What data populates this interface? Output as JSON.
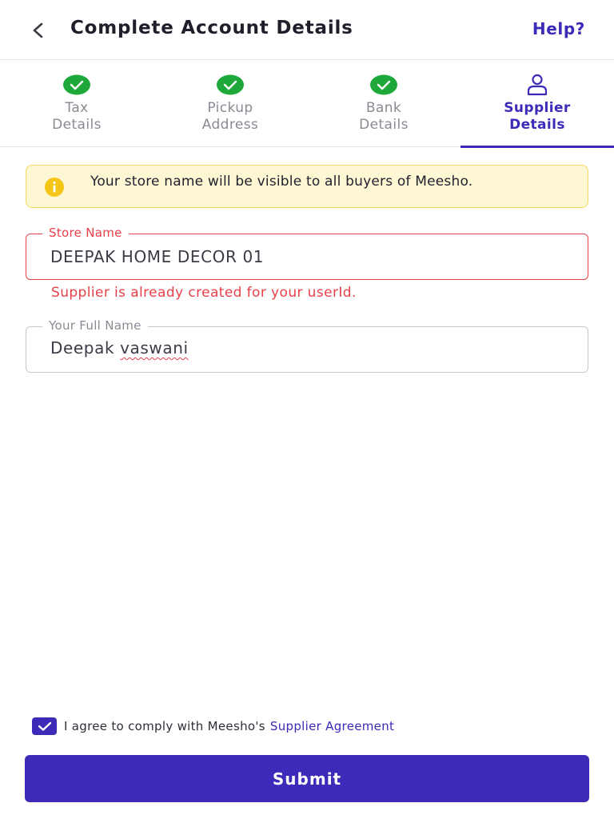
{
  "header": {
    "title": "Complete Account Details",
    "help_label": "Help?",
    "back_icon": "chevron-left-icon"
  },
  "steps": [
    {
      "label": "Tax\nDetails",
      "icon": "check-circle-icon",
      "status": "completed"
    },
    {
      "label": "Pickup\nAddress",
      "icon": "check-circle-icon",
      "status": "completed"
    },
    {
      "label": "Bank\nDetails",
      "icon": "check-circle-icon",
      "status": "completed"
    },
    {
      "label": "Supplier\nDetails",
      "icon": "user-icon",
      "status": "active"
    }
  ],
  "info_banner": {
    "text": "Your store name will be visible to all buyers of Meesho.",
    "icon": "info-icon"
  },
  "form": {
    "store_name": {
      "label": "Store Name",
      "value": "DEEPAK HOME DECOR 01",
      "error": "Supplier is already created for your userId."
    },
    "full_name": {
      "label": "Your Full Name",
      "value_first": "Deepak",
      "value_second": "vaswani"
    }
  },
  "agreement": {
    "checked": true,
    "text": "I agree to comply with Meesho's",
    "link_text": "Supplier Agreement"
  },
  "submit_label": "Submit",
  "colors": {
    "primary": "#3b2bb8",
    "success": "#1fa83a",
    "error": "#e8404a",
    "banner_bg": "#fdf7d4",
    "banner_border": "#f1da62",
    "info_icon": "#f5c518"
  }
}
